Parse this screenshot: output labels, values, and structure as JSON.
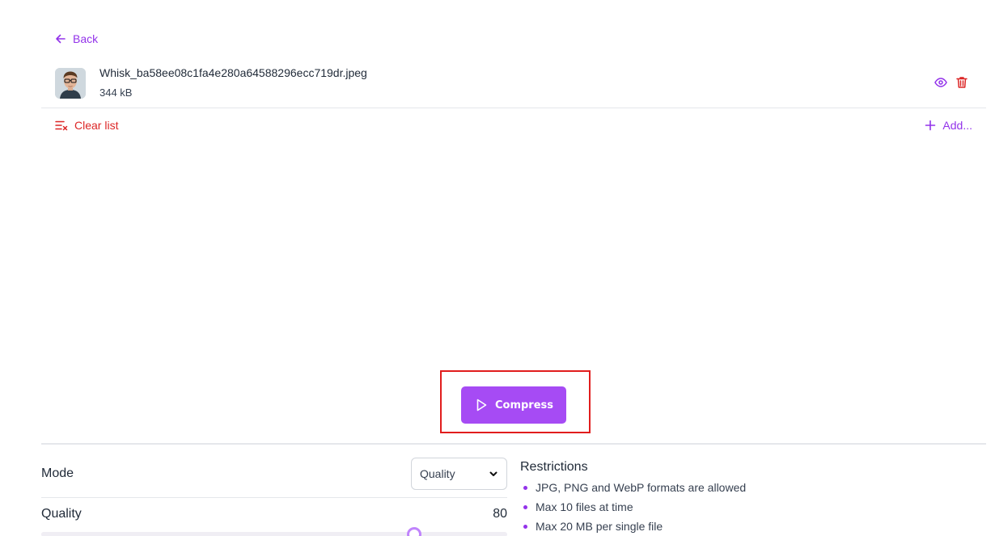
{
  "nav": {
    "back_label": "Back"
  },
  "file": {
    "name": "Whisk_ba58ee08c1fa4e280a64588296ecc719dr.jpeg",
    "size": "344 kB"
  },
  "list_toolbar": {
    "clear_label": "Clear list",
    "add_label": "Add..."
  },
  "action": {
    "compress_label": "Compress"
  },
  "settings": {
    "mode_label": "Mode",
    "mode_value": "Quality",
    "quality_label": "Quality",
    "quality_value": "80",
    "quality_fraction": 0.8
  },
  "restrictions": {
    "title": "Restrictions",
    "items": [
      "JPG, PNG and WebP formats are allowed",
      "Max 10 files at time",
      "Max 20 MB per single file"
    ]
  },
  "colors": {
    "accent": "#9333ea",
    "button": "#a64bf4",
    "danger": "#dc2626",
    "highlight": "#e11d1d"
  }
}
